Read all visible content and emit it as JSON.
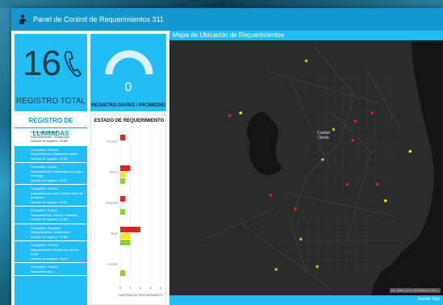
{
  "window": {
    "title": "Panel de Control de Requerimientos 311"
  },
  "total": {
    "value": "16",
    "label": "REGISTRO TOTAL"
  },
  "daily": {
    "value": "0",
    "label": "REGISTRO DIARIO / PROMEDIO",
    "gauge_fraction": 0
  },
  "log": {
    "title": "REGISTRO DE LLAMADAS",
    "items": [
      {
        "l1": "Compañía: Tenaris",
        "l2": "Requerimiento: Obstáculos",
        "l3": "Horario de registro: 18:68"
      },
      {
        "l1": "Compañía: Tenaris",
        "l2": "Requerimiento: Materiales tirado",
        "l3": "Horario de registro: 18:48"
      },
      {
        "l1": "Compañía: Gulma",
        "l2": "Requerimiento: Materiales con polvo de fuego",
        "l3": "Horario de registro: 14:00"
      },
      {
        "l1": "Compañía: Tenaris",
        "l2": "Requerimiento: Aux Camión lleno de personas",
        "l3": "Horario de registro: 00:00"
      },
      {
        "l1": "Compañía: Gulma",
        "l2": "Requerimiento: Ruidos molestos",
        "l3": "Horario de registro: 07:48"
      },
      {
        "l1": "Compañía: Segundo",
        "l2": "Requerimiento: Obstáculos",
        "l3": "Horario de registro: 10:48"
      },
      {
        "l1": "Compañía: Tenaris",
        "l2": "Requerimiento: Ruido con olor de fuego",
        "l3": "Horario de registro: 03:00"
      },
      {
        "l1": "Compañía: Tenaris",
        "l2": "Requerimiento: ...",
        "l3": ""
      }
    ]
  },
  "state_chart": {
    "title": "ESTADO DE REQUERIMIENTO",
    "xlabel": "CANTIDAD DE REQUERIMIENTO"
  },
  "chart_data": {
    "type": "bar",
    "title": "ESTADO DE REQUERIMIENTO",
    "xlabel": "CANTIDAD DE REQUERIMIENTO",
    "ylabel": "",
    "xlim": [
      0,
      8
    ],
    "x_ticks": [
      "0",
      "2",
      "4",
      "6",
      "8"
    ],
    "categories": [
      "Proceso",
      "Nuevo",
      "Asignado",
      "Tarde",
      "Cerrado"
    ],
    "series": [
      {
        "color": "#e8201f",
        "values": [
          1,
          2,
          1,
          4,
          0
        ]
      },
      {
        "color": "#ffe600",
        "values": [
          0,
          1,
          0,
          2,
          0
        ]
      },
      {
        "color": "#8fd22c",
        "values": [
          0,
          1,
          1,
          2,
          1
        ]
      }
    ]
  },
  "map": {
    "title": "Mapa de Ubicación de Requerimientos",
    "city_label_1": "Ciudad",
    "city_label_2": "Ojeda",
    "attribution": "Esri, HERE, Garmin, INCREMENT P, NGA...",
    "footer": "Fuente: Rep",
    "points": [
      {
        "color": "#8fd22c",
        "x": 0.5,
        "y": 0.11
      },
      {
        "color": "#ffe600",
        "x": 0.26,
        "y": 0.3
      },
      {
        "color": "#e8201f",
        "x": 0.22,
        "y": 0.31
      },
      {
        "color": "#e8201f",
        "x": 0.68,
        "y": 0.33
      },
      {
        "color": "#8fd22c",
        "x": 0.6,
        "y": 0.36
      },
      {
        "color": "#e8201f",
        "x": 0.67,
        "y": 0.4
      },
      {
        "color": "#e8201f",
        "x": 0.74,
        "y": 0.3
      },
      {
        "color": "#ffe600",
        "x": 0.88,
        "y": 0.44
      },
      {
        "color": "#8fd22c",
        "x": 0.56,
        "y": 0.47
      },
      {
        "color": "#e8201f",
        "x": 0.65,
        "y": 0.56
      },
      {
        "color": "#e8201f",
        "x": 0.37,
        "y": 0.6
      },
      {
        "color": "#e8201f",
        "x": 0.46,
        "y": 0.65
      },
      {
        "color": "#ffe600",
        "x": 0.79,
        "y": 0.62
      },
      {
        "color": "#e8201f",
        "x": 0.76,
        "y": 0.56
      },
      {
        "color": "#8fd22c",
        "x": 0.48,
        "y": 0.76
      },
      {
        "color": "#8fd22c",
        "x": 0.54,
        "y": 0.86
      },
      {
        "color": "#8fd22c",
        "x": 0.39,
        "y": 0.87
      }
    ]
  }
}
